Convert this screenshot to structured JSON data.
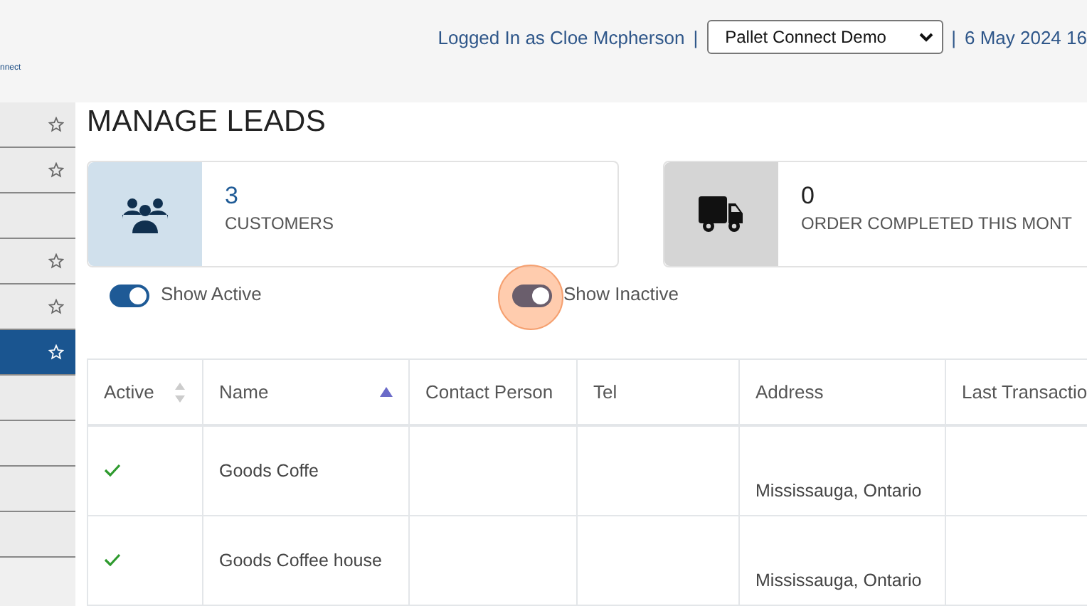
{
  "header": {
    "logo_text": "nnect",
    "logged_in": "Logged In as Cloe Mcpherson",
    "separator": "|",
    "company_select": {
      "value": "Pallet Connect Demo"
    },
    "separator_2": "|",
    "date": "6 May 2024 16"
  },
  "sidebar": {
    "items": [
      {
        "starred": true,
        "selected": false
      },
      {
        "starred": true,
        "selected": false
      },
      {
        "starred": false,
        "selected": false
      },
      {
        "starred": true,
        "selected": false
      },
      {
        "starred": true,
        "selected": false
      },
      {
        "starred": true,
        "selected": true
      },
      {
        "starred": false,
        "selected": false
      },
      {
        "starred": false,
        "selected": false
      },
      {
        "starred": false,
        "selected": false
      },
      {
        "starred": false,
        "selected": false
      }
    ]
  },
  "page_title": "MANAGE LEADS",
  "stats": [
    {
      "kind": "customers",
      "value": "3",
      "label": "CUSTOMERS"
    },
    {
      "kind": "orders",
      "value": "0",
      "label": "ORDER COMPLETED THIS MONT"
    }
  ],
  "toggles": [
    {
      "label": "Show Active",
      "on": true,
      "highlighted": false,
      "color": "#1e5a96"
    },
    {
      "label": "Show Inactive",
      "on": true,
      "highlighted": true,
      "color": "#6a5e6c"
    }
  ],
  "table": {
    "columns": [
      {
        "label": "Active",
        "sortable": true,
        "sorted": false
      },
      {
        "label": "Name",
        "sorted": true
      },
      {
        "label": "Contact Person",
        "sortable": false,
        "sorted": false
      },
      {
        "label": "Tel",
        "sortable": false,
        "sorted": false
      },
      {
        "label": "Address",
        "sortable": false,
        "sorted": false
      },
      {
        "label": "Last Transactio"
      }
    ],
    "rows": [
      {
        "active": true,
        "name": "Goods Coffe",
        "address": "Mississauga, Ontario"
      },
      {
        "active": true,
        "name": "Goods Coffee house",
        "address": "Mississauga, Ontario"
      }
    ]
  }
}
